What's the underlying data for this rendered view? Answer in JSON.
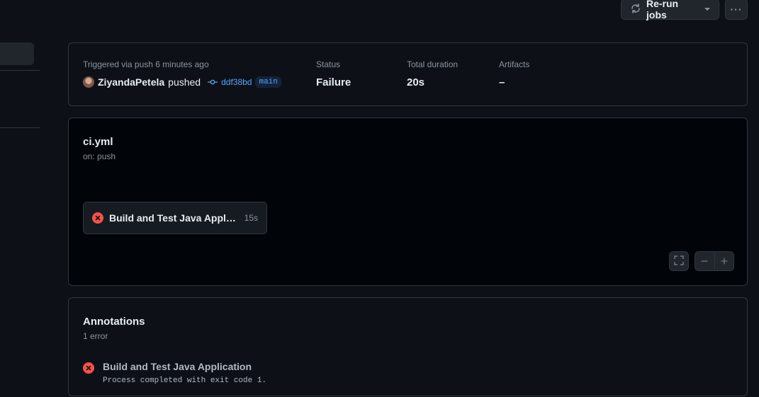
{
  "header": {
    "rerun_label": "Re-run jobs",
    "more_label": "···"
  },
  "summary": {
    "triggered_text": "Triggered via push 6 minutes ago",
    "user": "ZiyandaPetela",
    "action": "pushed",
    "commit_sha": "ddf38bd",
    "branch": "main",
    "status_label": "Status",
    "status_value": "Failure",
    "duration_label": "Total duration",
    "duration_value": "20s",
    "artifacts_label": "Artifacts",
    "artifacts_value": "–"
  },
  "workflow": {
    "file": "ci.yml",
    "trigger": "on: push",
    "job": {
      "name": "Build and Test Java Applicat...",
      "duration": "15s",
      "status": "failure"
    }
  },
  "annotations": {
    "title": "Annotations",
    "count": "1 error",
    "items": [
      {
        "job": "Build and Test Java Application",
        "message": "Process completed with exit code 1."
      }
    ]
  },
  "colors": {
    "background": "#0d1117",
    "graph_background": "#010409",
    "border": "#30363d",
    "link": "#58a6ff",
    "error": "#f85149",
    "muted": "#8b949e"
  },
  "icons": [
    "sync-icon",
    "caret-down-icon",
    "kebab-horizontal-icon",
    "avatar",
    "git-commit-icon",
    "x-circle-fill-icon",
    "screen-full-icon",
    "minus-icon",
    "plus-icon"
  ]
}
